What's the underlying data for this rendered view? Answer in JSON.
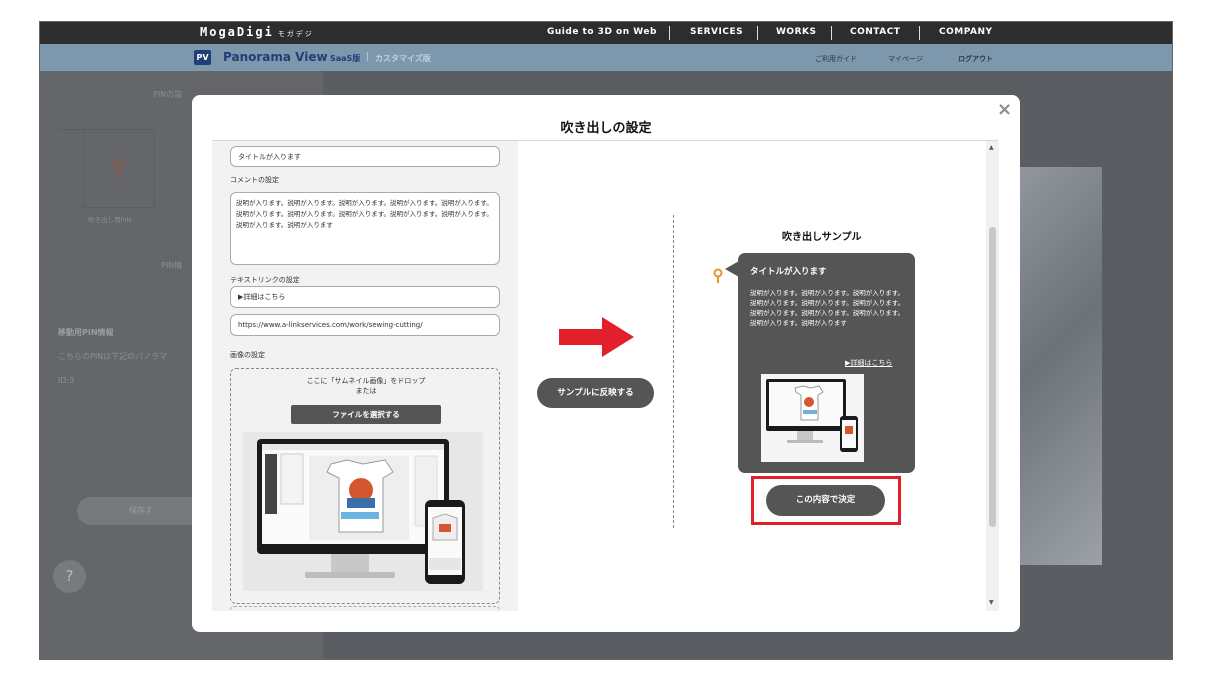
{
  "topnav": {
    "logo": "MogaDigi",
    "logo_sub": "モガデジ",
    "items": [
      "Guide to 3D on Web",
      "SERVICES",
      "WORKS",
      "CONTACT",
      "COMPANY"
    ]
  },
  "subnav": {
    "badge": "PV",
    "title": "Panorama View",
    "saas": "SaaS版",
    "separator": "|",
    "custom": "カスタマイズ版",
    "links": [
      "ご利用ガイド",
      "マイページ",
      "ログアウト"
    ]
  },
  "background": {
    "pin_settings": "PINの設",
    "bubble_pin": "吹き出し用PIN",
    "pin_info": "PIN情",
    "move_pin_heading": "移動用PIN情報",
    "move_pin_desc": "こちらのPINは下記のパノラマ",
    "id": "ID:3",
    "save_button": "保存す",
    "help": "?"
  },
  "modal": {
    "title": "吹き出しの設定",
    "close": "×",
    "form": {
      "title_value": "タイトルが入ります",
      "comment_label": "コメントの設定",
      "comment_value": "説明が入ります。説明が入ります。説明が入ります。説明が入ります。説明が入ります。説明が入ります。説明が入ります。説明が入ります。説明が入ります。説明が入ります。説明が入ります。説明が入ります",
      "textlink_label": "テキストリンクの設定",
      "link_text_value": "▶詳細はこちら",
      "link_url_value": "https://www.a-linkservices.com/work/sewing-cutting/",
      "image_label": "画像の設定",
      "drop_text_line1": "ここに「サムネイル画像」をドロップ",
      "drop_text_line2": "または",
      "file_button": "ファイルを選択する"
    },
    "apply_button": "サンプルに反映する",
    "sample": {
      "heading": "吹き出しサンプル",
      "bubble_title": "タイトルが入ります",
      "bubble_body": "説明が入ります。説明が入ります。説明が入ります。説明が入ります。説明が入ります。説明が入ります。説明が入ります。説明が入ります。説明が入ります。説明が入ります。説明が入ります",
      "bubble_link": "▶詳細はこちら",
      "decide_button": "この内容で決定"
    }
  },
  "colors": {
    "highlight": "#e2202c",
    "arrow": "#e2202c",
    "pin": "#e8922e",
    "header": "#2d2d2d",
    "subheader": "#7d98ad"
  }
}
